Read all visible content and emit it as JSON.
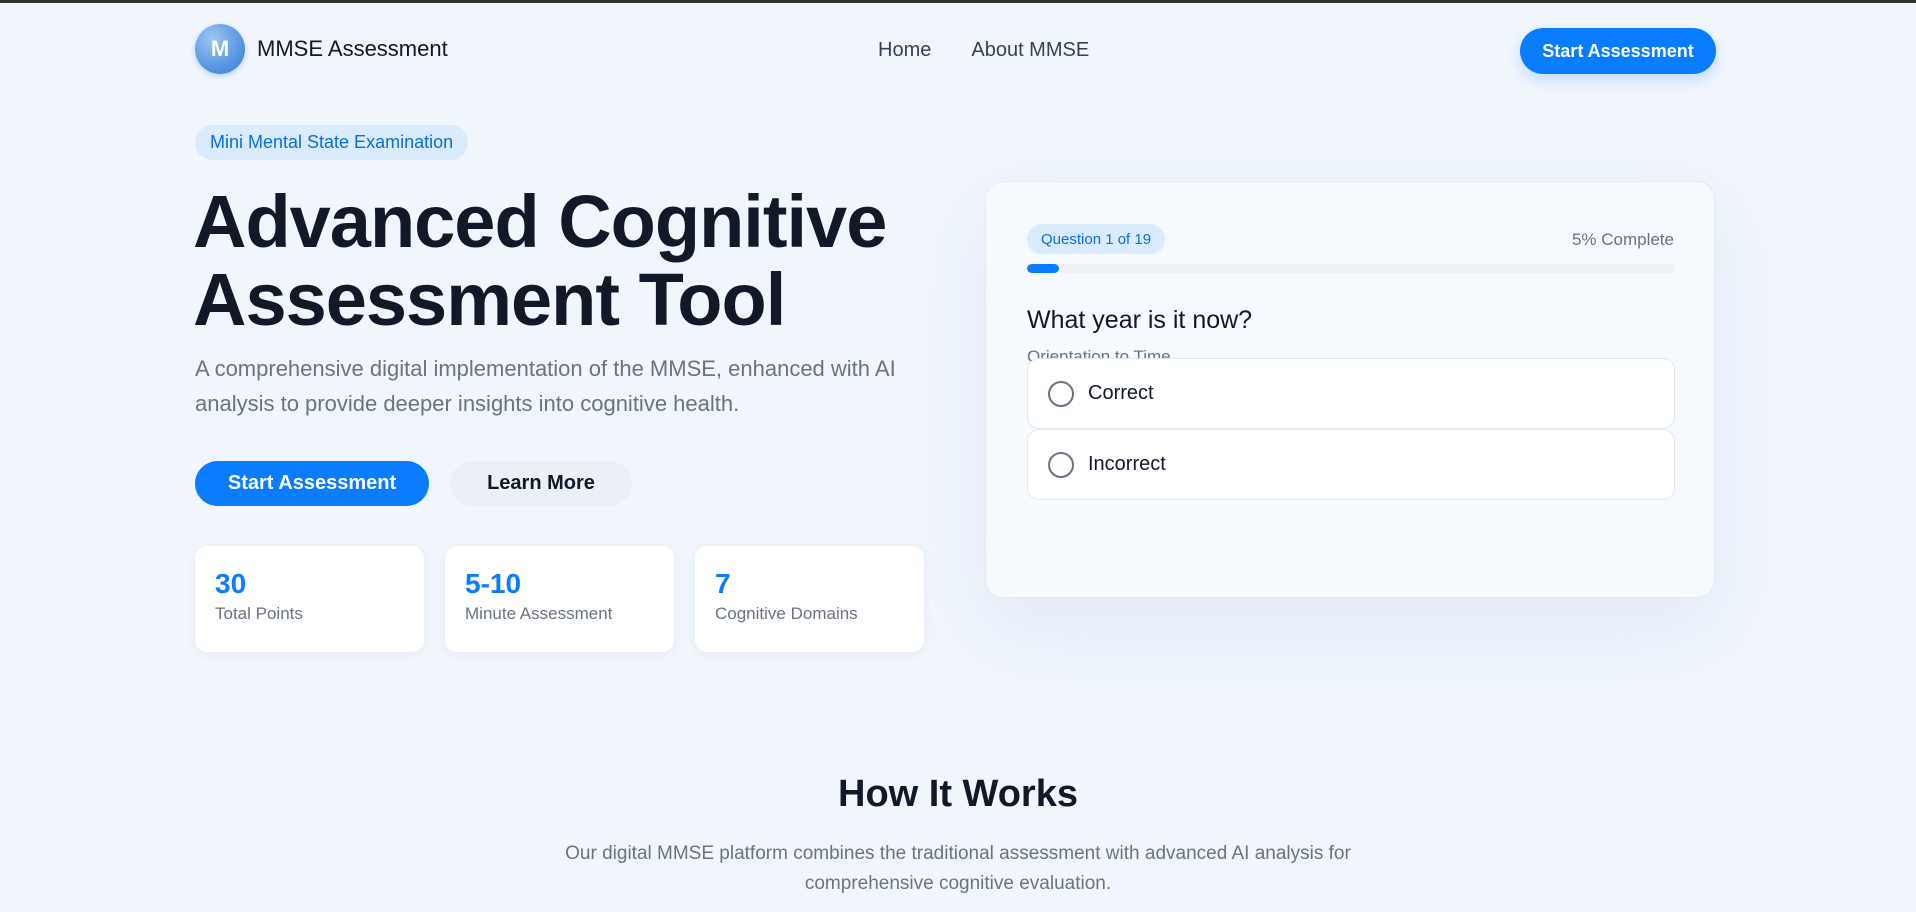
{
  "header": {
    "logo_letter": "M",
    "brand_name": "MMSE Assessment",
    "nav": [
      {
        "label": "Home"
      },
      {
        "label": "About MMSE"
      }
    ],
    "cta_label": "Start Assessment"
  },
  "hero": {
    "pill": "Mini Mental State Examination",
    "title_line1": "Advanced Cognitive",
    "title_line2": "Assessment Tool",
    "subtitle": "A comprehensive digital implementation of the MMSE, enhanced with AI analysis to provide deeper insights into cognitive health.",
    "primary_button": "Start Assessment",
    "secondary_button": "Learn More",
    "stats": [
      {
        "value": "30",
        "label": "Total Points"
      },
      {
        "value": "5-10",
        "label": "Minute Assessment"
      },
      {
        "value": "7",
        "label": "Cognitive Domains"
      }
    ]
  },
  "question_card": {
    "badge": "Question 1 of 19",
    "progress_text": "5% Complete",
    "progress_fraction": 0.05,
    "question": "What year is it now?",
    "category": "Orientation to Time",
    "options": [
      {
        "label": "Correct",
        "selected": false
      },
      {
        "label": "Incorrect",
        "selected": false
      }
    ]
  },
  "how_it_works": {
    "title": "How It Works",
    "description": "Our digital MMSE platform combines the traditional assessment with advanced AI analysis for comprehensive cognitive evaluation."
  },
  "colors": {
    "accent": "#0a7cff",
    "page_bg": "#f1f6fd",
    "text_primary": "#111827",
    "text_muted": "#6b7280",
    "pill_bg": "#d9ebfd"
  }
}
